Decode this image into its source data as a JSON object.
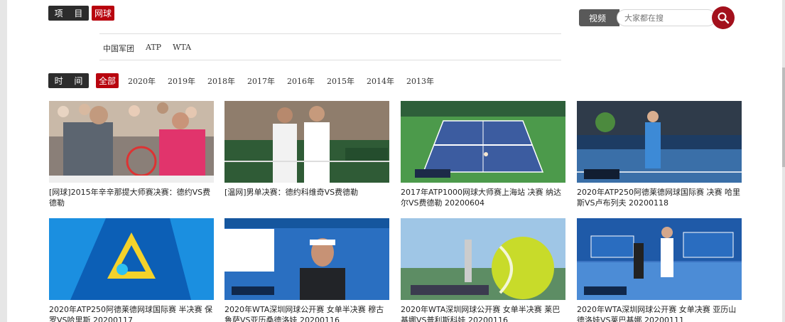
{
  "filters": {
    "category_label": "项 目",
    "category_active": "网球",
    "sub_links": [
      "中国军团",
      "ATP",
      "WTA"
    ],
    "time_label": "时 间",
    "years": [
      "全部",
      "2020年",
      "2019年",
      "2018年",
      "2017年",
      "2016年",
      "2015年",
      "2014年",
      "2013年"
    ]
  },
  "search": {
    "label": "视频",
    "placeholder": "大家都在搜",
    "icon": "search-icon"
  },
  "videos": [
    {
      "title": "[网球]2015年辛辛那提大师赛决赛：德约VS费德勒",
      "thumb": "handshake-crowd"
    },
    {
      "title": "[温网]男单决赛：德约科维奇VS费德勒",
      "thumb": "handshake-net"
    },
    {
      "title": "2017年ATP1000网球大师赛上海站 决赛 纳达尔VS费德勒 20200604",
      "thumb": "court-green"
    },
    {
      "title": "2020年ATP250阿德莱德网球国际赛 决赛 哈里斯VS卢布列夫 20200118",
      "thumb": "court-blue"
    },
    {
      "title": "2020年ATP250阿德莱德网球国际赛 半决赛 保罗VS哈里斯 20200117",
      "thumb": "logo-blue"
    },
    {
      "title": "2020年WTA深圳网球公开赛 女单半决赛 穆古鲁萨VS亚历桑德洛娃 20200116",
      "thumb": "player-portrait"
    },
    {
      "title": "2020年WTA深圳网球公开赛 女单半决赛 莱巴基娜VS普利斯科娃 20200116",
      "thumb": "ball-closeup"
    },
    {
      "title": "2020年WTA深圳网球公开赛 女单决赛 亚历山德洛娃VS莱巴基娜 20200111",
      "thumb": "court-shenzhen"
    }
  ]
}
